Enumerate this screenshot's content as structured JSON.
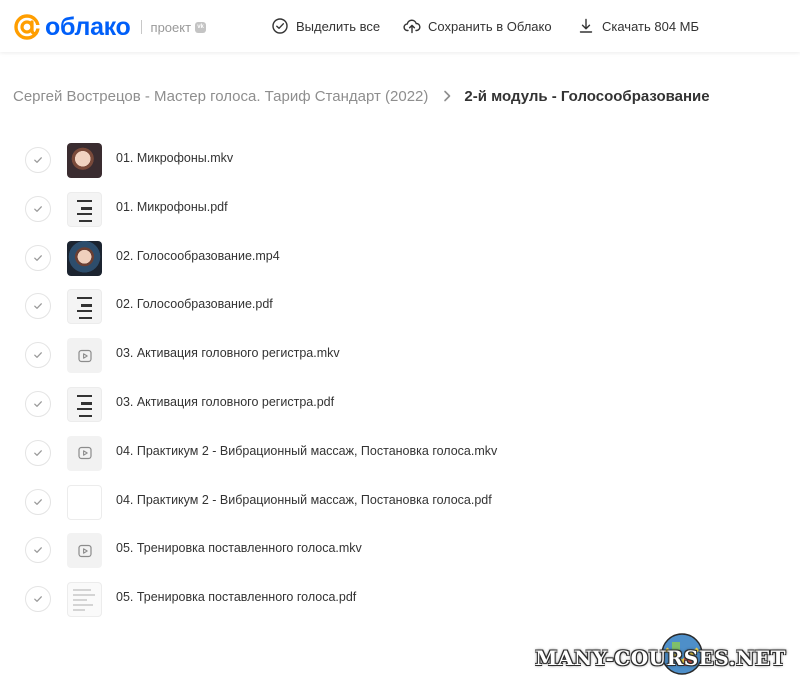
{
  "header": {
    "logo_text": "облако",
    "project_label": "проект",
    "vk_badge": "vk",
    "select_all": "Выделить все",
    "save_to_cloud": "Сохранить в Облако",
    "download": "Скачать 804 МБ"
  },
  "breadcrumb": {
    "parent": "Сергей Вострецов - Мастер голоса. Тариф Стандарт (2022)",
    "current": "2-й модуль - Голосообразование"
  },
  "files": [
    {
      "name": "01. Микрофоны.mkv",
      "thumb": "video-photo"
    },
    {
      "name": "01. Микрофоны.pdf",
      "thumb": "pdf"
    },
    {
      "name": "02. Голосообразование.mp4",
      "thumb": "video-photo2"
    },
    {
      "name": "02. Голосообразование.pdf",
      "thumb": "pdf"
    },
    {
      "name": "03. Активация головного регистра.mkv",
      "thumb": "video"
    },
    {
      "name": "03. Активация головного регистра.pdf",
      "thumb": "pdf"
    },
    {
      "name": "04. Практикум 2 - Вибрационный массаж, Постановка голоса.mkv",
      "thumb": "video"
    },
    {
      "name": "04. Практикум 2 - Вибрационный массаж, Постановка голоса.pdf",
      "thumb": "blank"
    },
    {
      "name": "05. Тренировка поставленного голоса.mkv",
      "thumb": "video"
    },
    {
      "name": "05. Тренировка поставленного голоса.pdf",
      "thumb": "doc"
    }
  ],
  "watermark": "MANY-COURSES.NET",
  "colors": {
    "brand_blue": "#005ff9",
    "logo_orange": "#ff9e00"
  }
}
